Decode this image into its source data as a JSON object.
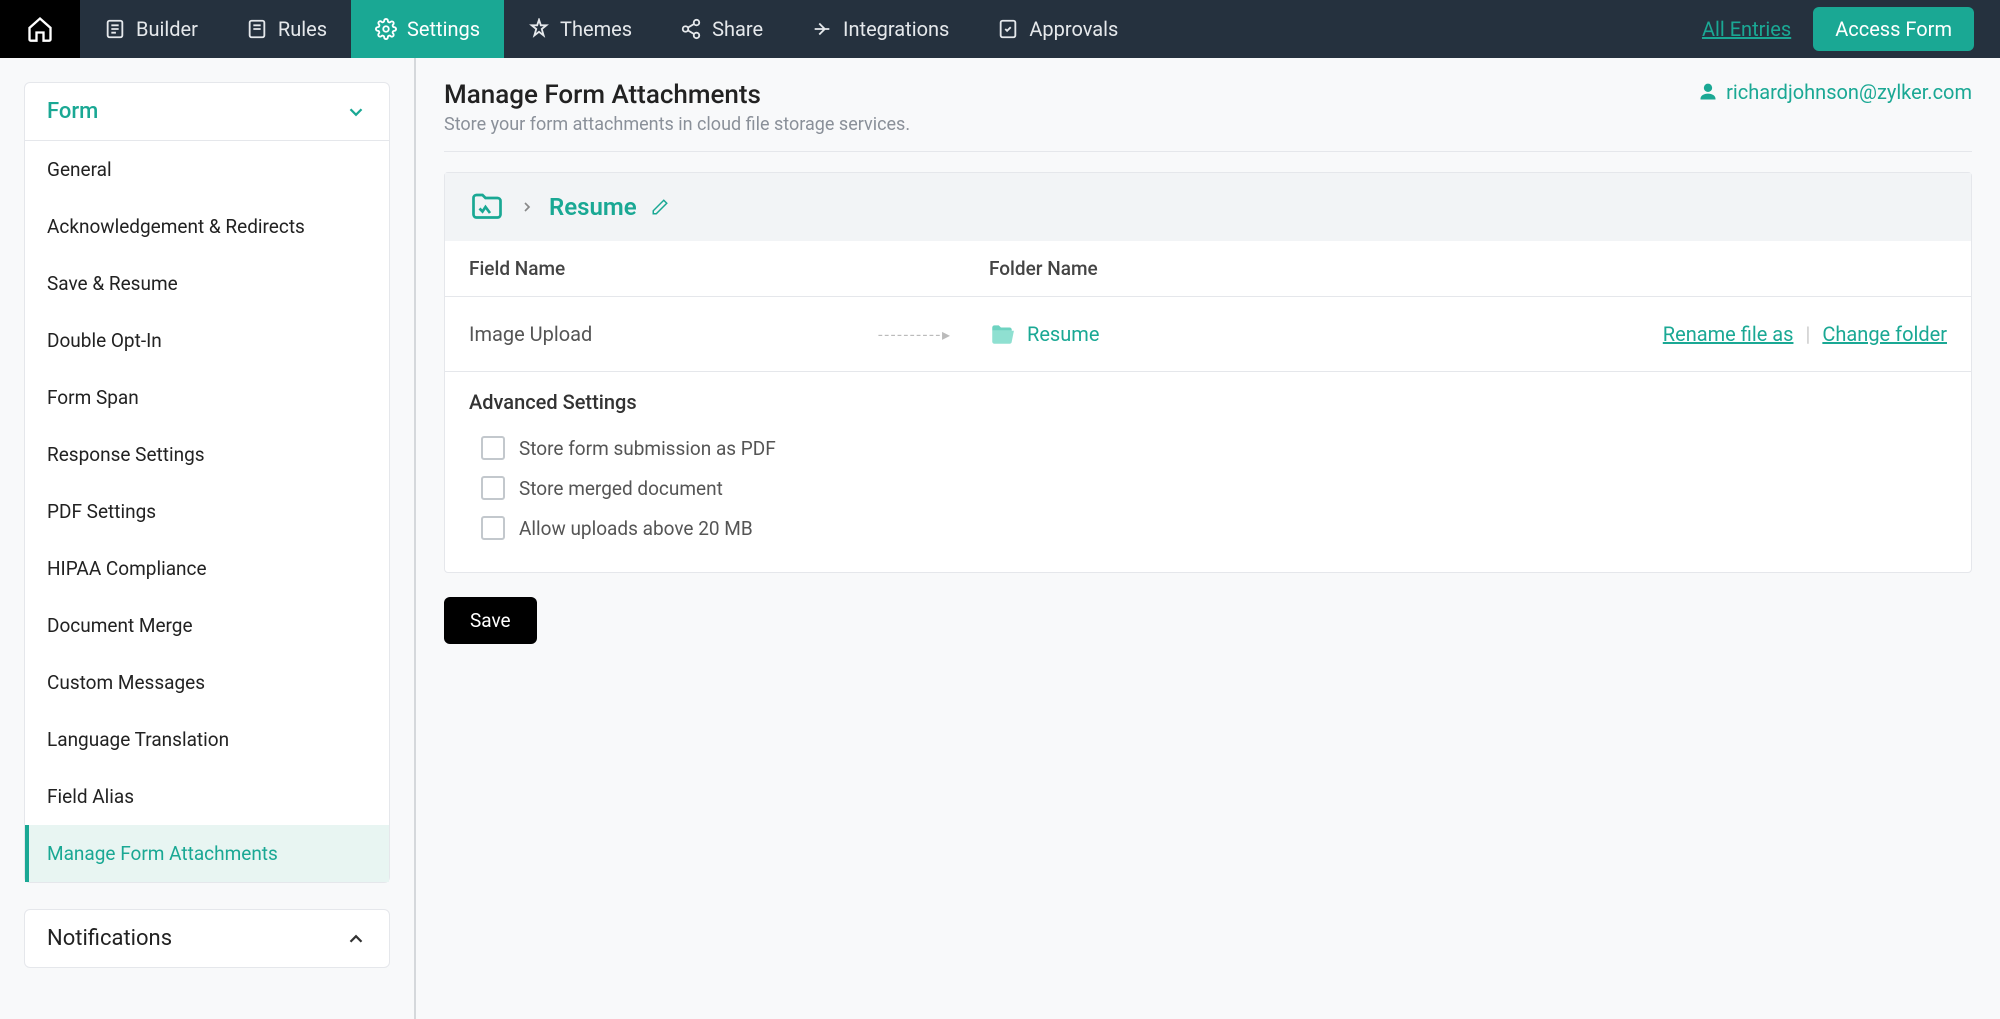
{
  "topnav": {
    "items": [
      {
        "label": "Builder"
      },
      {
        "label": "Rules"
      },
      {
        "label": "Settings"
      },
      {
        "label": "Themes"
      },
      {
        "label": "Share"
      },
      {
        "label": "Integrations"
      },
      {
        "label": "Approvals"
      }
    ],
    "all_entries": "All Entries",
    "access_form": "Access Form"
  },
  "sidebar": {
    "form_header": "Form",
    "items": [
      "General",
      "Acknowledgement & Redirects",
      "Save & Resume",
      "Double Opt-In",
      "Form Span",
      "Response Settings",
      "PDF Settings",
      "HIPAA Compliance",
      "Document Merge",
      "Custom Messages",
      "Language Translation",
      "Field Alias",
      "Manage Form Attachments"
    ],
    "notifications_header": "Notifications"
  },
  "page": {
    "title": "Manage Form Attachments",
    "subtitle": "Store your form attachments in cloud file storage services.",
    "user_email": "richardjohnson@zylker.com"
  },
  "breadcrumb": {
    "folder": "Resume"
  },
  "table": {
    "header_field": "Field Name",
    "header_folder": "Folder Name",
    "row": {
      "field": "Image Upload",
      "folder": "Resume",
      "rename": "Rename file as",
      "change": "Change folder"
    }
  },
  "advanced": {
    "title": "Advanced Settings",
    "opts": [
      "Store form submission as PDF",
      "Store merged document",
      "Allow uploads above 20 MB"
    ]
  },
  "save_label": "Save"
}
